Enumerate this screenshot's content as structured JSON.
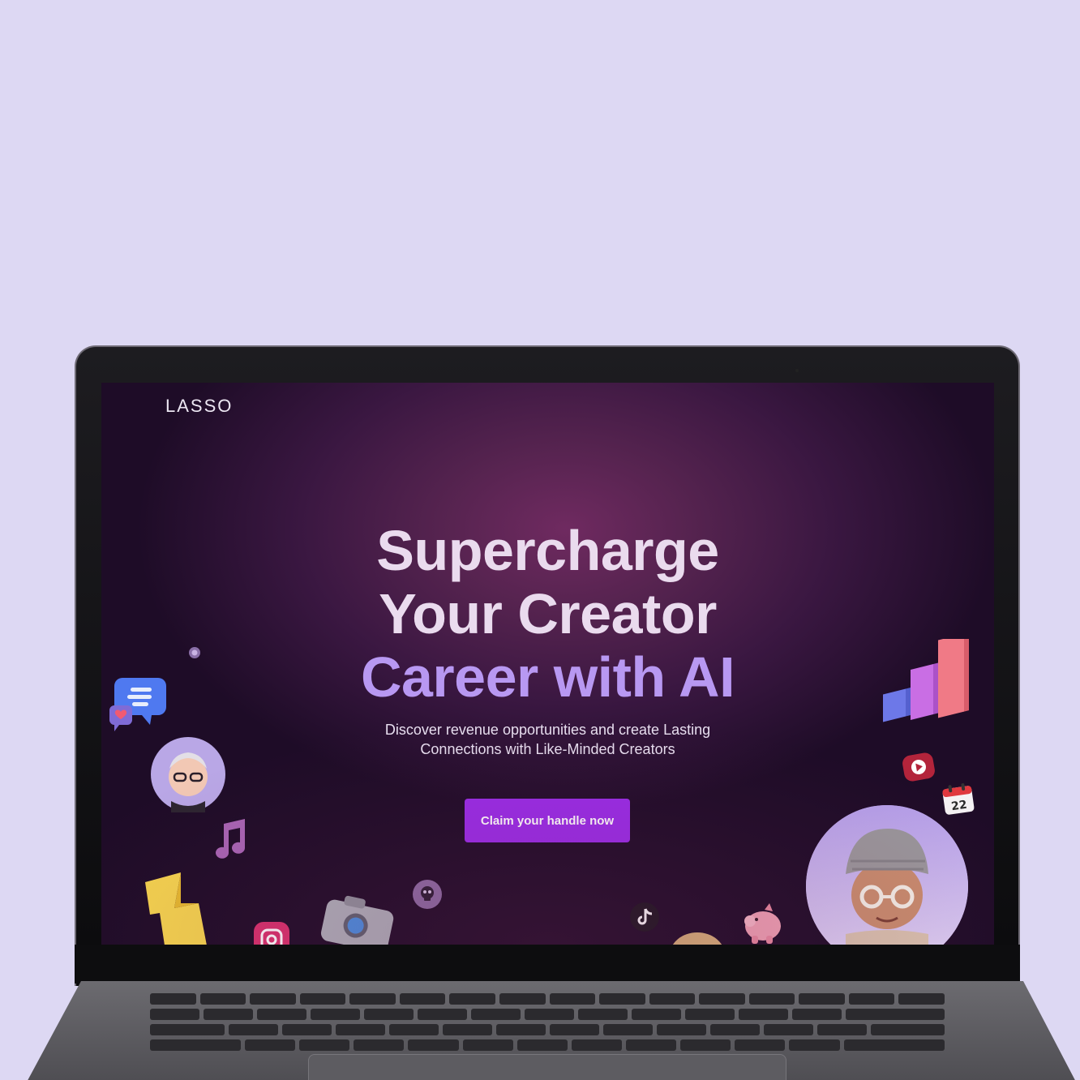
{
  "site": {
    "logo": "LASSO"
  },
  "hero": {
    "title_line1": "Supercharge",
    "title_line2": "Your Creator",
    "title_line3": "Career with AI",
    "subtitle_line1": "Discover revenue opportunities and create Lasting",
    "subtitle_line2": "Connections with Like-Minded Creators",
    "cta_label": "Claim your handle now"
  },
  "theme": {
    "accent": "#9a2ce8",
    "headline": "#eadbee",
    "headline_accent": "#b898f2",
    "background_outer": "#ddd8f3"
  },
  "decorations": {
    "calendar_day": "22",
    "icons": [
      "chat-bubble-icon",
      "heart-icon",
      "avatar-woman",
      "music-note-icon",
      "lightning-icon",
      "instagram-icon",
      "camera-icon",
      "skull-badge-icon",
      "tiktok-icon",
      "piggy-bank-icon",
      "bar-chart-icon",
      "youtube-icon",
      "calendar-icon",
      "avatar-man"
    ]
  }
}
